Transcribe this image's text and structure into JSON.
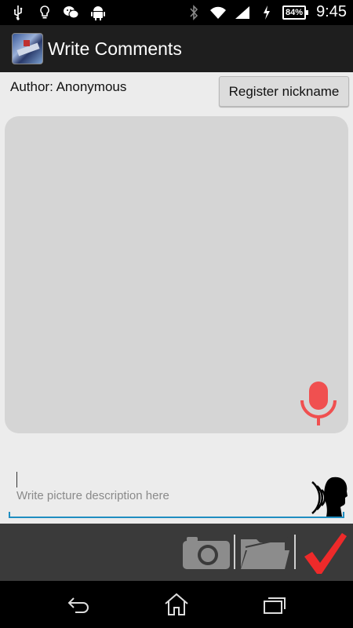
{
  "status_bar": {
    "battery": "84%",
    "time": "9:45"
  },
  "action_bar": {
    "title": "Write Comments"
  },
  "author": {
    "label": "Author: Anonymous"
  },
  "register_button": {
    "label": "Register nickname"
  },
  "description": {
    "value": "",
    "placeholder": "Write picture description here"
  },
  "colors": {
    "mic_red": "#f05050",
    "check_red": "#ee2a2a",
    "input_underline": "#1f8ec1"
  },
  "icons": {
    "status_left": [
      "usb-icon",
      "lightbulb-icon",
      "wechat-icon",
      "android-icon"
    ],
    "status_right": [
      "bluetooth-icon",
      "wifi-icon",
      "signal-icon",
      "charging-icon",
      "battery-icon"
    ],
    "toolbar": [
      "camera-icon",
      "folder-icon",
      "checkmark-icon"
    ],
    "navigation": [
      "back-icon",
      "home-icon",
      "recent-apps-icon"
    ]
  }
}
